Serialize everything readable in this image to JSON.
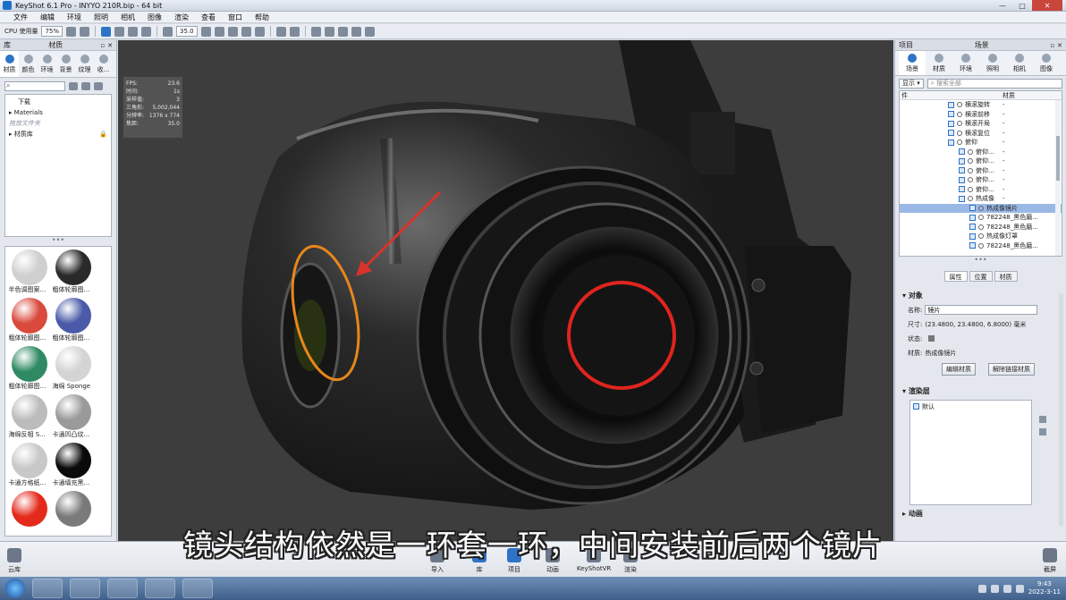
{
  "window": {
    "title": "KeyShot 6.1 Pro  -  INYYO 210R.bip  -  64 bit",
    "controls": [
      "—",
      "□",
      "✕"
    ]
  },
  "menu": [
    "文件",
    "编辑",
    "环境",
    "照明",
    "相机",
    "图像",
    "渲染",
    "查看",
    "窗口",
    "帮助"
  ],
  "toolbar": {
    "cpu_label": "CPU 使用量",
    "cpu_value": "75%",
    "focal_value": "35.0"
  },
  "left_panel": {
    "header": {
      "library": "库",
      "materials": "材质"
    },
    "tabs": [
      "材质",
      "颜色",
      "环境",
      "背景",
      "纹理",
      "收..."
    ],
    "tree": {
      "download": "下载",
      "materials_folder": "Materials",
      "drop_hint": "拖放文件夹",
      "material_lib": "材质库"
    },
    "thumbnails": [
      {
        "label": "半色调图案...",
        "color": "#cfcfcf"
      },
      {
        "label": "粗体轮廓图...",
        "color": "#2a2a2a"
      },
      {
        "label": "粗体轮廓图...",
        "color": "#d94a3d"
      },
      {
        "label": "粗体轮廓图...",
        "color": "#4a5aa8"
      },
      {
        "label": "粗体轮廓图...",
        "color": "#2f8a63"
      },
      {
        "label": "海绵 Sponge",
        "color": "#d4d4d4"
      },
      {
        "label": "海绵反相 S...",
        "color": "#bcbcbc"
      },
      {
        "label": "卡通凹凸纹...",
        "color": "#9a9a9a"
      },
      {
        "label": "卡通方格纸...",
        "color": "#c8c8c8"
      },
      {
        "label": "卡通填充黑...",
        "color": "#0a0a0a"
      },
      {
        "label": "",
        "color": "#e42a1c"
      },
      {
        "label": "",
        "color": "#7a7a7a"
      }
    ]
  },
  "stats": [
    {
      "k": "FPS:",
      "v": "23.6"
    },
    {
      "k": "时间:",
      "v": "1s"
    },
    {
      "k": "采样值:",
      "v": "3"
    },
    {
      "k": "三角形:",
      "v": "5,002,044"
    },
    {
      "k": "分辨率:",
      "v": "1376 x 774"
    },
    {
      "k": "焦距:",
      "v": "35.0"
    }
  ],
  "right_panel": {
    "header": {
      "project": "项目",
      "scene": "场景"
    },
    "tabs": [
      "场景",
      "材质",
      "环境",
      "照明",
      "相机",
      "图像"
    ],
    "search": {
      "dropdown": "显示",
      "placeholder": "搜索全部"
    },
    "columns": {
      "name": "件",
      "material": "材质"
    },
    "rows": [
      {
        "name": "横滚旋转",
        "material": "-",
        "indent": 1,
        "sel": false
      },
      {
        "name": "横滚前移",
        "material": "-",
        "indent": 1,
        "sel": false
      },
      {
        "name": "横滚开局",
        "material": "-",
        "indent": 1,
        "sel": false
      },
      {
        "name": "横滚复位",
        "material": "-",
        "indent": 1,
        "sel": false
      },
      {
        "name": "俯仰",
        "material": "-",
        "indent": 1,
        "sel": false
      },
      {
        "name": "俯仰...",
        "material": "-",
        "indent": 2,
        "sel": false
      },
      {
        "name": "俯仰...",
        "material": "-",
        "indent": 2,
        "sel": false
      },
      {
        "name": "俯仰...",
        "material": "-",
        "indent": 2,
        "sel": false
      },
      {
        "name": "俯仰...",
        "material": "-",
        "indent": 2,
        "sel": false
      },
      {
        "name": "俯仰...",
        "material": "-",
        "indent": 2,
        "sel": false
      },
      {
        "name": "热成像",
        "material": "-",
        "indent": 2,
        "sel": false
      },
      {
        "name": "热成像镜片",
        "material": "",
        "indent": 3,
        "sel": true
      },
      {
        "name": "782248_黑色磨...",
        "material": "",
        "indent": 3,
        "sel": false
      },
      {
        "name": "782248_黑色磨...",
        "material": "",
        "indent": 3,
        "sel": false
      },
      {
        "name": "热成像灯罩",
        "material": "",
        "indent": 3,
        "sel": false
      },
      {
        "name": "782248_黑色磨...",
        "material": "",
        "indent": 3,
        "sel": false
      }
    ],
    "prop_tabs": [
      "属性",
      "位置",
      "材质"
    ],
    "object_section": "对象",
    "name_label": "名称:",
    "name_value": "镜片",
    "size_label": "尺寸:",
    "size_value": "(23.4800, 23.4800, 6.8000) 毫米",
    "state_label": "状态:",
    "material_label": "材质:",
    "material_value": "热成像镜片",
    "edit_material_btn": "编辑材质",
    "unlink_material_btn": "解除链接材质",
    "render_layers_section": "渲染层",
    "default_layer": "默认",
    "anim_section": "动画"
  },
  "ribbon": {
    "cloud": "云库",
    "buttons": [
      "导入",
      "库",
      "项目",
      "动画",
      "KeyShotVR",
      "渲染"
    ],
    "screenshot": "截屏"
  },
  "taskbar": {
    "time": "9:43",
    "date": "2022-3-11"
  },
  "subtitle": "镜头结构依然是一环套一环，中间安装前后两个镜片",
  "colors": {
    "accent": "#2d73c7",
    "annotation_circle": "#e0241e",
    "annotation_ellipse": "#e8871c",
    "annotation_arrow": "#d8332a"
  }
}
